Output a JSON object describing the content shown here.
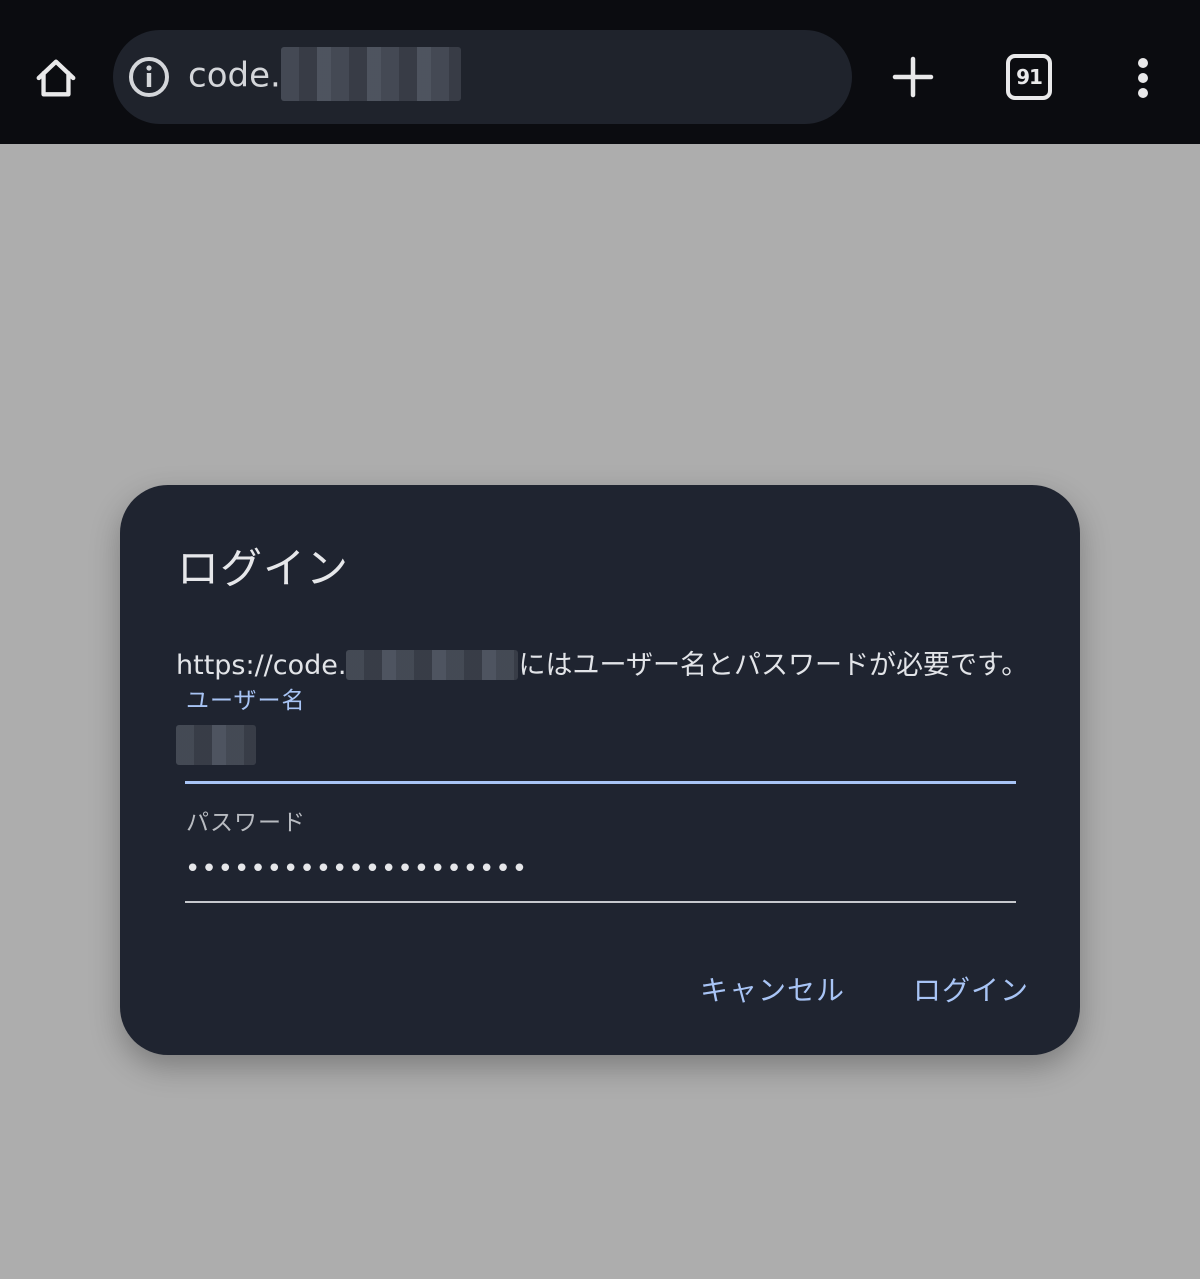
{
  "browser": {
    "url_visible": "code.",
    "tab_count": "91",
    "icons": {
      "home": "home-icon",
      "site_info": "info-icon",
      "new_tab": "plus-icon",
      "tabs": "tab-switcher-icon",
      "menu": "more-vert-icon"
    }
  },
  "dialog": {
    "title": "ログイン",
    "message_prefix": "https://code.",
    "message_suffix": "にはユーザー名とパスワードが必要です。",
    "username_label": "ユーザー名",
    "password_label": "パスワード",
    "password_value": "•••••••••••••••••••••",
    "cancel_label": "キャンセル",
    "login_label": "ログイン"
  },
  "colors": {
    "toolbar_bg": "#0b0c10",
    "page_bg": "#adadad",
    "dialog_bg": "#1f2430",
    "accent": "#a8c4f5"
  }
}
